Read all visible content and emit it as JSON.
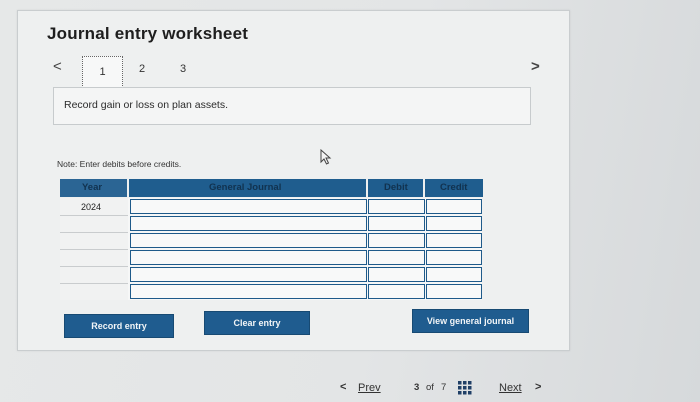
{
  "worksheet": {
    "title": "Journal entry worksheet",
    "steps": [
      "1",
      "2",
      "3"
    ],
    "prev_arrow": "<",
    "next_arrow": ">",
    "instruction": "Record gain or loss on plan assets.",
    "note": "Note: Enter debits before credits."
  },
  "table": {
    "headers": {
      "year": "Year",
      "general_journal": "General Journal",
      "debit": "Debit",
      "credit": "Credit"
    },
    "rows": [
      {
        "year": "2024",
        "account": "",
        "debit": "",
        "credit": ""
      },
      {
        "year": "",
        "account": "",
        "debit": "",
        "credit": ""
      },
      {
        "year": "",
        "account": "",
        "debit": "",
        "credit": ""
      },
      {
        "year": "",
        "account": "",
        "debit": "",
        "credit": ""
      },
      {
        "year": "",
        "account": "",
        "debit": "",
        "credit": ""
      },
      {
        "year": "",
        "account": "",
        "debit": "",
        "credit": ""
      }
    ]
  },
  "buttons": {
    "record_entry": "Record entry",
    "clear_entry": "Clear entry",
    "view_general_journal": "View general journal"
  },
  "footer": {
    "prev_arrow": "<",
    "prev_label": "Prev",
    "page_current": "3",
    "page_of": "of",
    "page_total": "7",
    "next_label": "Next",
    "next_arrow": ">"
  },
  "colors": {
    "accent_blue": "#1f5c8f",
    "header_text": "#11324f",
    "background": "#dfe2e3"
  }
}
